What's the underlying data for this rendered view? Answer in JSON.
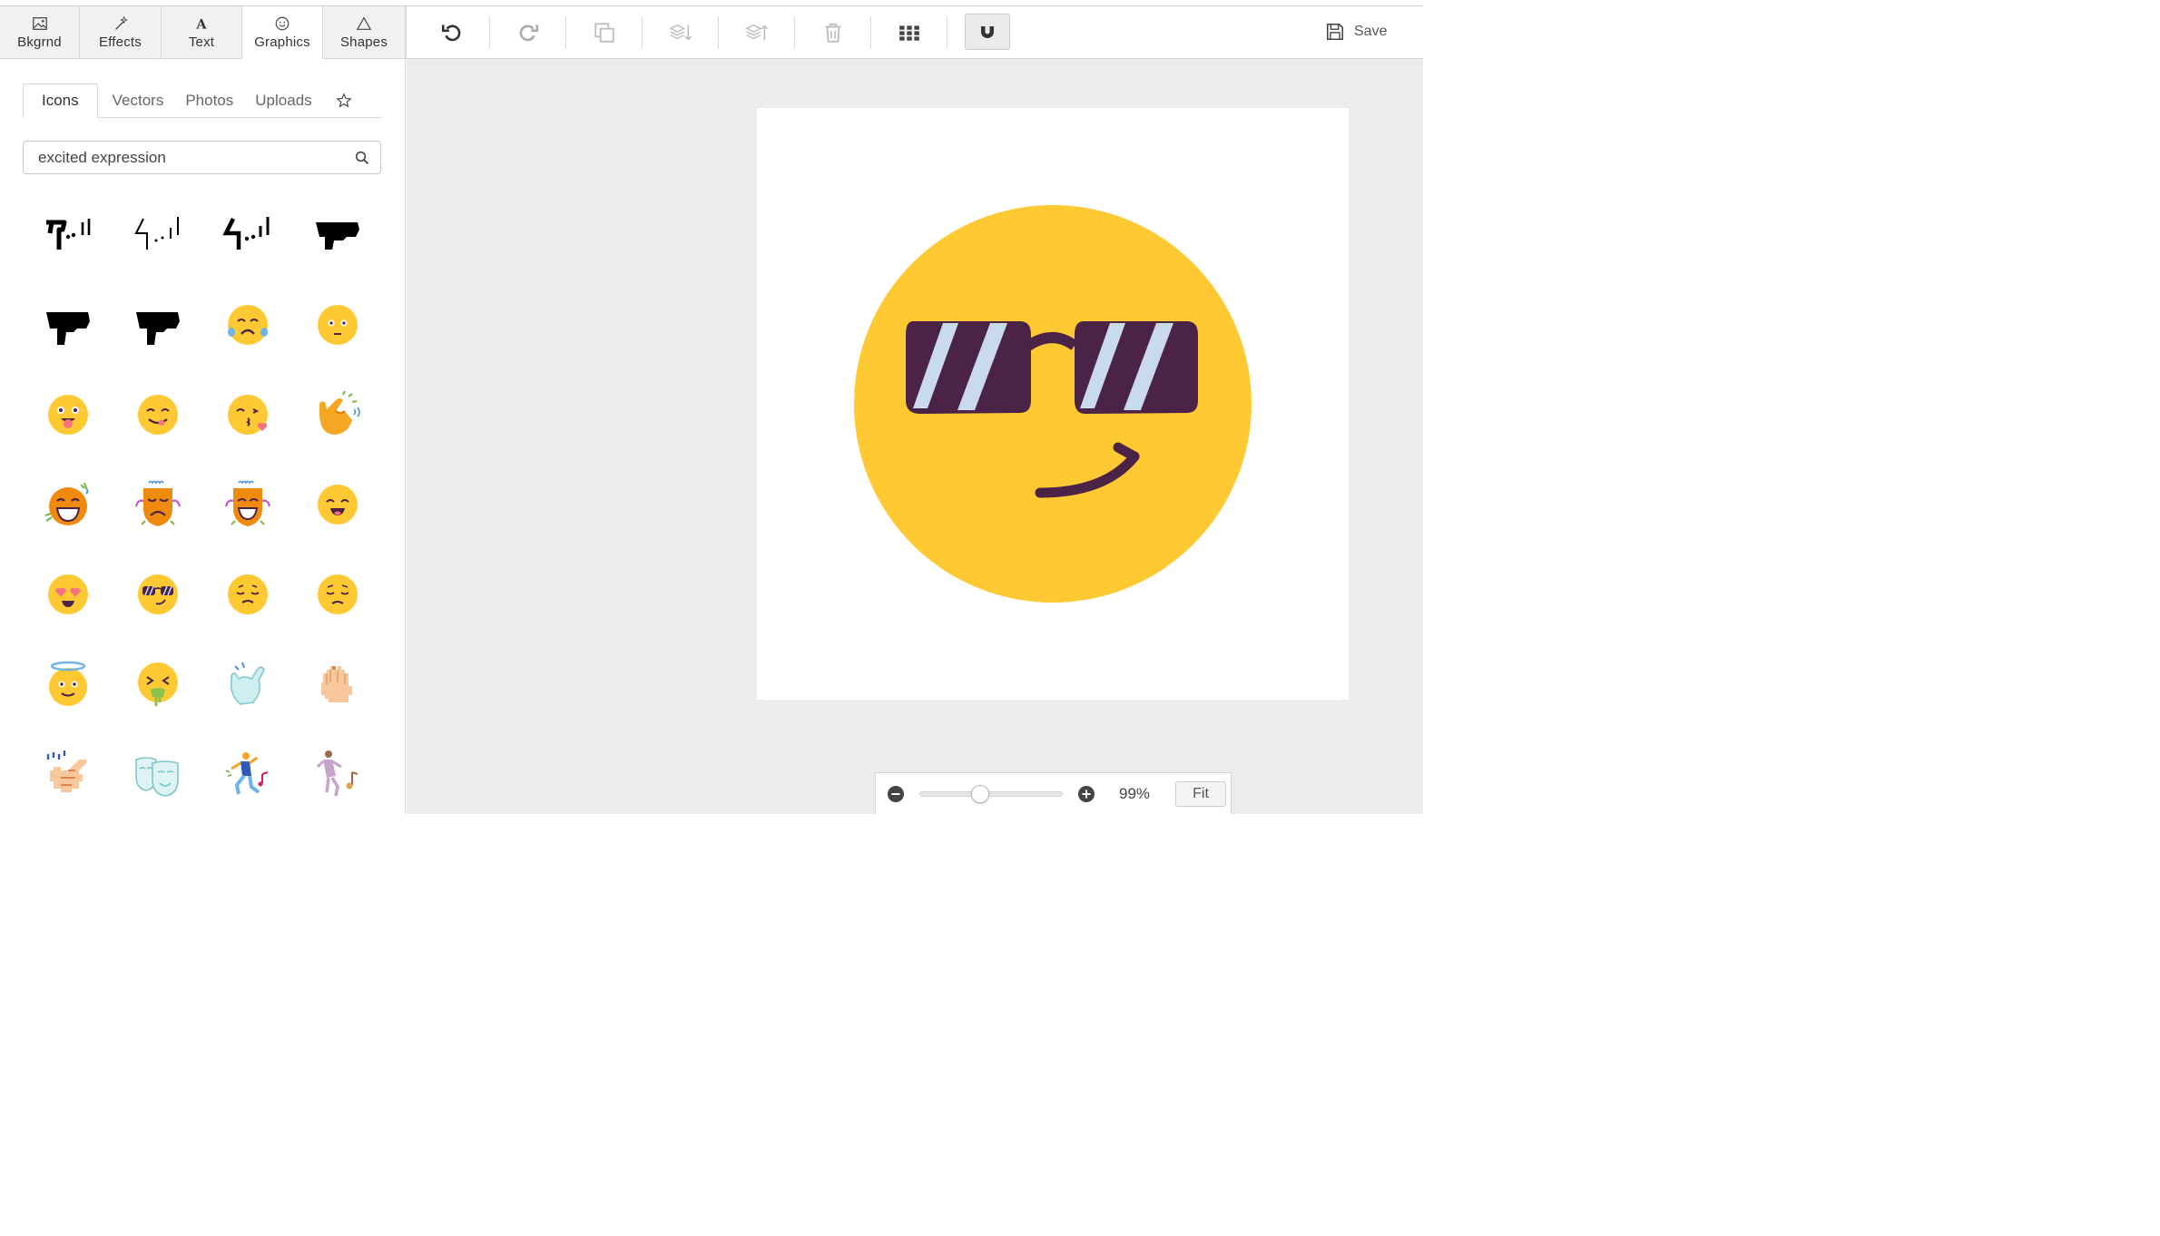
{
  "main_tabs": [
    {
      "label": "Bkgrnd",
      "icon": "image-icon"
    },
    {
      "label": "Effects",
      "icon": "magic-wand-icon"
    },
    {
      "label": "Text",
      "icon": "text-icon"
    },
    {
      "label": "Graphics",
      "icon": "smiley-icon",
      "active": true
    },
    {
      "label": "Shapes",
      "icon": "triangle-icon"
    }
  ],
  "toolbar": {
    "undo": "undo-icon",
    "redo": "redo-icon",
    "duplicate": "duplicate-icon",
    "send_back": "send-backward-icon",
    "bring_forward": "bring-forward-icon",
    "delete": "trash-icon",
    "grid": "grid-icon",
    "snap": "magnet-icon",
    "save_label": "Save"
  },
  "sub_tabs": [
    {
      "label": "Icons",
      "active": true
    },
    {
      "label": "Vectors"
    },
    {
      "label": "Photos"
    },
    {
      "label": "Uploads"
    },
    {
      "label": "",
      "icon": "star-icon"
    }
  ],
  "search": {
    "value": "excited expression"
  },
  "results": [
    "hand-tremor-icon",
    "hand-tremor-outline-icon",
    "hand-tremor-bold-icon",
    "hand-palm-down-icon",
    "hand-point-down-icon",
    "hand-point-down-2-icon",
    "crying-face-icon",
    "neutral-face-icon",
    "tongue-out-face-icon",
    "yummy-face-icon",
    "kissing-face-icon",
    "snapping-hand-icon",
    "laughing-face-icon",
    "sad-mask-icon",
    "happy-mask-icon",
    "grinning-face-icon",
    "heart-eyes-face-icon",
    "sunglasses-face-icon",
    "sleepy-face-icon",
    "disappointed-face-icon",
    "angel-face-icon",
    "vomiting-face-icon",
    "pointing-hand-icon",
    "raised-hand-icon",
    "pointing-hand-pixel-icon",
    "theater-masks-icon",
    "dancing-man-icon",
    "dancing-woman-icon"
  ],
  "canvas": {
    "graphic": "sunglasses-face-icon",
    "face_color": "#FFC933",
    "glasses_color": "#4A2346",
    "lens_stripe_color": "#C9D9EE"
  },
  "zoom": {
    "value": 0.99,
    "label": "99%",
    "fit_label": "Fit"
  }
}
